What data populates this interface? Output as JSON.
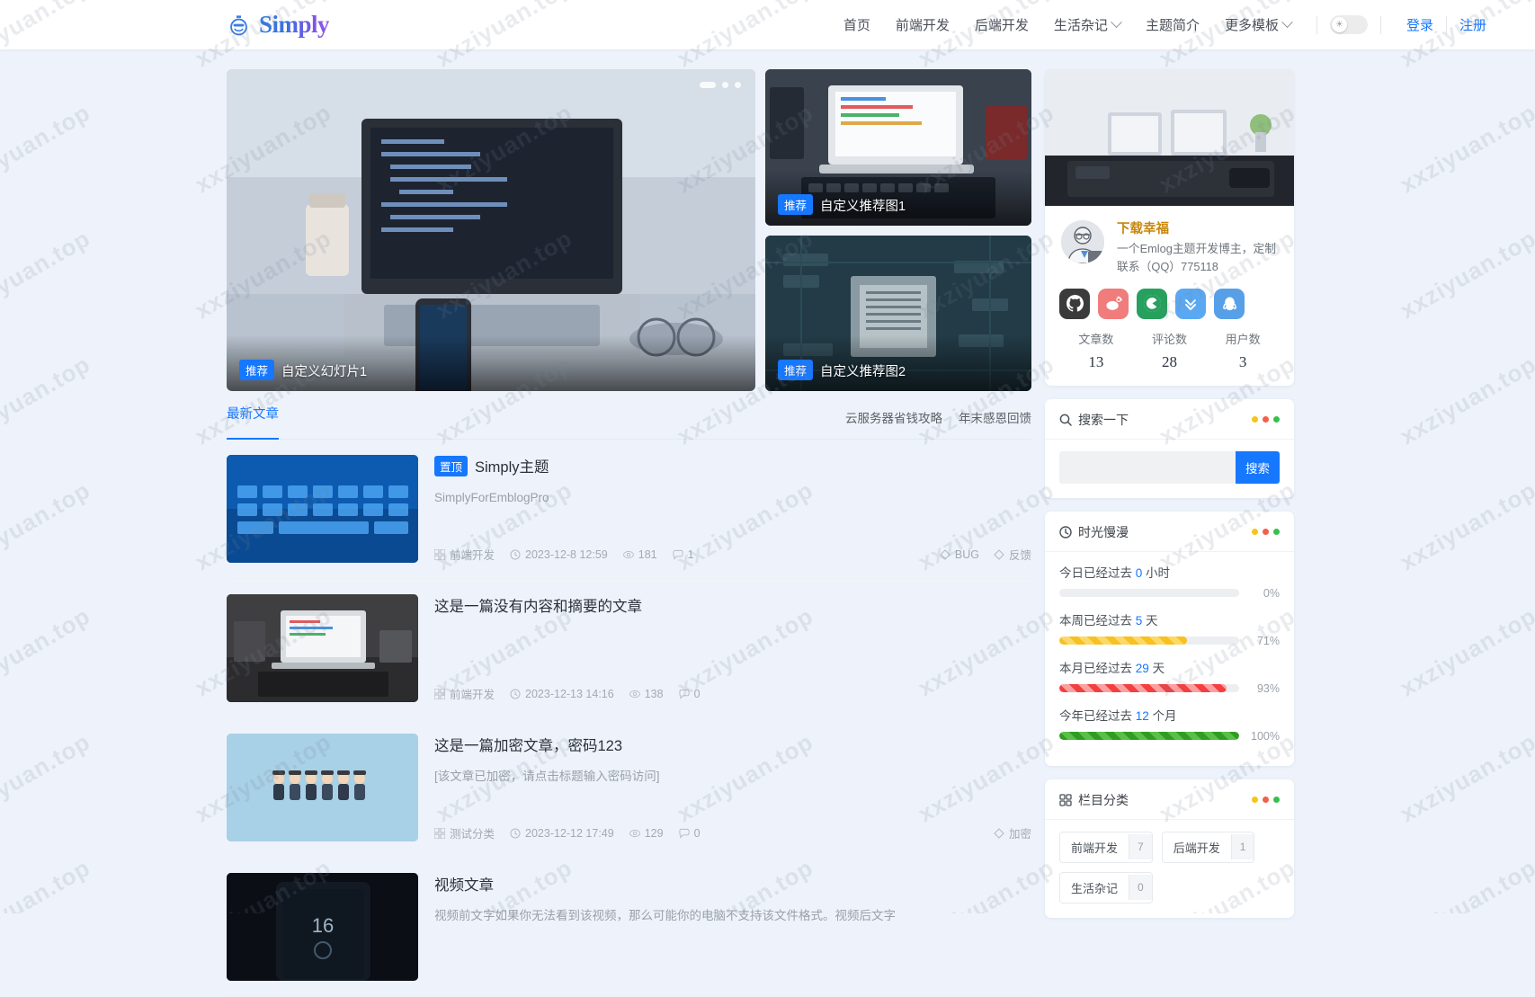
{
  "header": {
    "logo_text": "Simply",
    "logo_icon": "smiley-face-icon",
    "nav": [
      {
        "label": "首页",
        "has_chevron": false
      },
      {
        "label": "前端开发",
        "has_chevron": false
      },
      {
        "label": "后端开发",
        "has_chevron": false
      },
      {
        "label": "生活杂记",
        "has_chevron": true
      },
      {
        "label": "主题简介",
        "has_chevron": false
      },
      {
        "label": "更多模板",
        "has_chevron": true
      }
    ],
    "theme_toggle_icon": "sun-icon",
    "login_label": "登录",
    "register_label": "注册",
    "accent_color": "#1677ff"
  },
  "hero": {
    "slide": {
      "badge": "推荐",
      "title": "自定义幻灯片1"
    },
    "features": [
      {
        "badge": "推荐",
        "title": "自定义推荐图1"
      },
      {
        "badge": "推荐",
        "title": "自定义推荐图2"
      }
    ]
  },
  "list": {
    "tabs": [
      {
        "label": "最新文章",
        "active": true
      }
    ],
    "head_links": [
      "云服务器省钱攻略",
      "年末感恩回馈"
    ],
    "posts": [
      {
        "sticky_badge": "置顶",
        "title": "Simply主题",
        "excerpt": "SimplyForEmblogPro",
        "category": "前端开发",
        "date": "2023-12-8 12:59",
        "views": "181",
        "comments": "1",
        "tags": [
          "BUG",
          "反馈"
        ]
      },
      {
        "sticky_badge": "",
        "title": "这是一篇没有内容和摘要的文章",
        "excerpt": "",
        "category": "前端开发",
        "date": "2023-12-13 14:16",
        "views": "138",
        "comments": "0",
        "tags": []
      },
      {
        "sticky_badge": "",
        "title": "这是一篇加密文章，密码123",
        "excerpt": "[该文章已加密，请点击标题输入密码访问]",
        "category": "测试分类",
        "date": "2023-12-12 17:49",
        "views": "129",
        "comments": "0",
        "tags": [
          "加密"
        ]
      },
      {
        "sticky_badge": "",
        "title": "视频文章",
        "excerpt": "视频前文字如果你无法看到该视频，那么可能你的电脑不支持该文件格式。视频后文字",
        "category": "",
        "date": "",
        "views": "",
        "comments": "",
        "tags": []
      }
    ]
  },
  "sidebar": {
    "profile": {
      "name": "下载幸福",
      "desc": "一个Emlog主题开发博主，定制联系（QQ）775118",
      "socials": [
        {
          "name": "github-icon",
          "color": "#3b3b3b",
          "glyph": "⌬"
        },
        {
          "name": "weibo-icon",
          "color": "#f07c7c",
          "glyph": "◕"
        },
        {
          "name": "csdn-icon",
          "color": "#27a05e",
          "glyph": "C"
        },
        {
          "name": "chevrons-down-icon",
          "color": "#5aa8f2",
          "glyph": "⌄"
        },
        {
          "name": "qq-icon",
          "color": "#57a0e8",
          "glyph": "🐧"
        }
      ],
      "stats": [
        {
          "label": "文章数",
          "value": "13"
        },
        {
          "label": "评论数",
          "value": "28"
        },
        {
          "label": "用户数",
          "value": "3"
        }
      ]
    },
    "search": {
      "title": "搜索一下",
      "icon": "search-icon",
      "input_value": "",
      "placeholder": "",
      "button_label": "搜索"
    },
    "time": {
      "title": "时光慢漫",
      "icon": "clock-icon",
      "rows": [
        {
          "prefix": "今日已经过去",
          "value": "0",
          "suffix": "小时",
          "percent": "0%",
          "fill": 0,
          "style": "none"
        },
        {
          "prefix": "本周已经过去",
          "value": "5",
          "suffix": "天",
          "percent": "71%",
          "fill": 71,
          "style": "yellow"
        },
        {
          "prefix": "本月已经过去",
          "value": "29",
          "suffix": "天",
          "percent": "93%",
          "fill": 93,
          "style": "red"
        },
        {
          "prefix": "今年已经过去",
          "value": "12",
          "suffix": "个月",
          "percent": "100%",
          "fill": 100,
          "style": "green"
        }
      ]
    },
    "categories": {
      "title": "栏目分类",
      "icon": "grid-icon",
      "items": [
        {
          "name": "前端开发",
          "count": "7"
        },
        {
          "name": "后端开发",
          "count": "1"
        },
        {
          "name": "生活杂记",
          "count": "0"
        }
      ]
    },
    "window_dots": [
      {
        "color": "#f5c518"
      },
      {
        "color": "#f2604c"
      },
      {
        "color": "#35c14a"
      }
    ]
  },
  "watermark_text": "xxziyuan.top"
}
